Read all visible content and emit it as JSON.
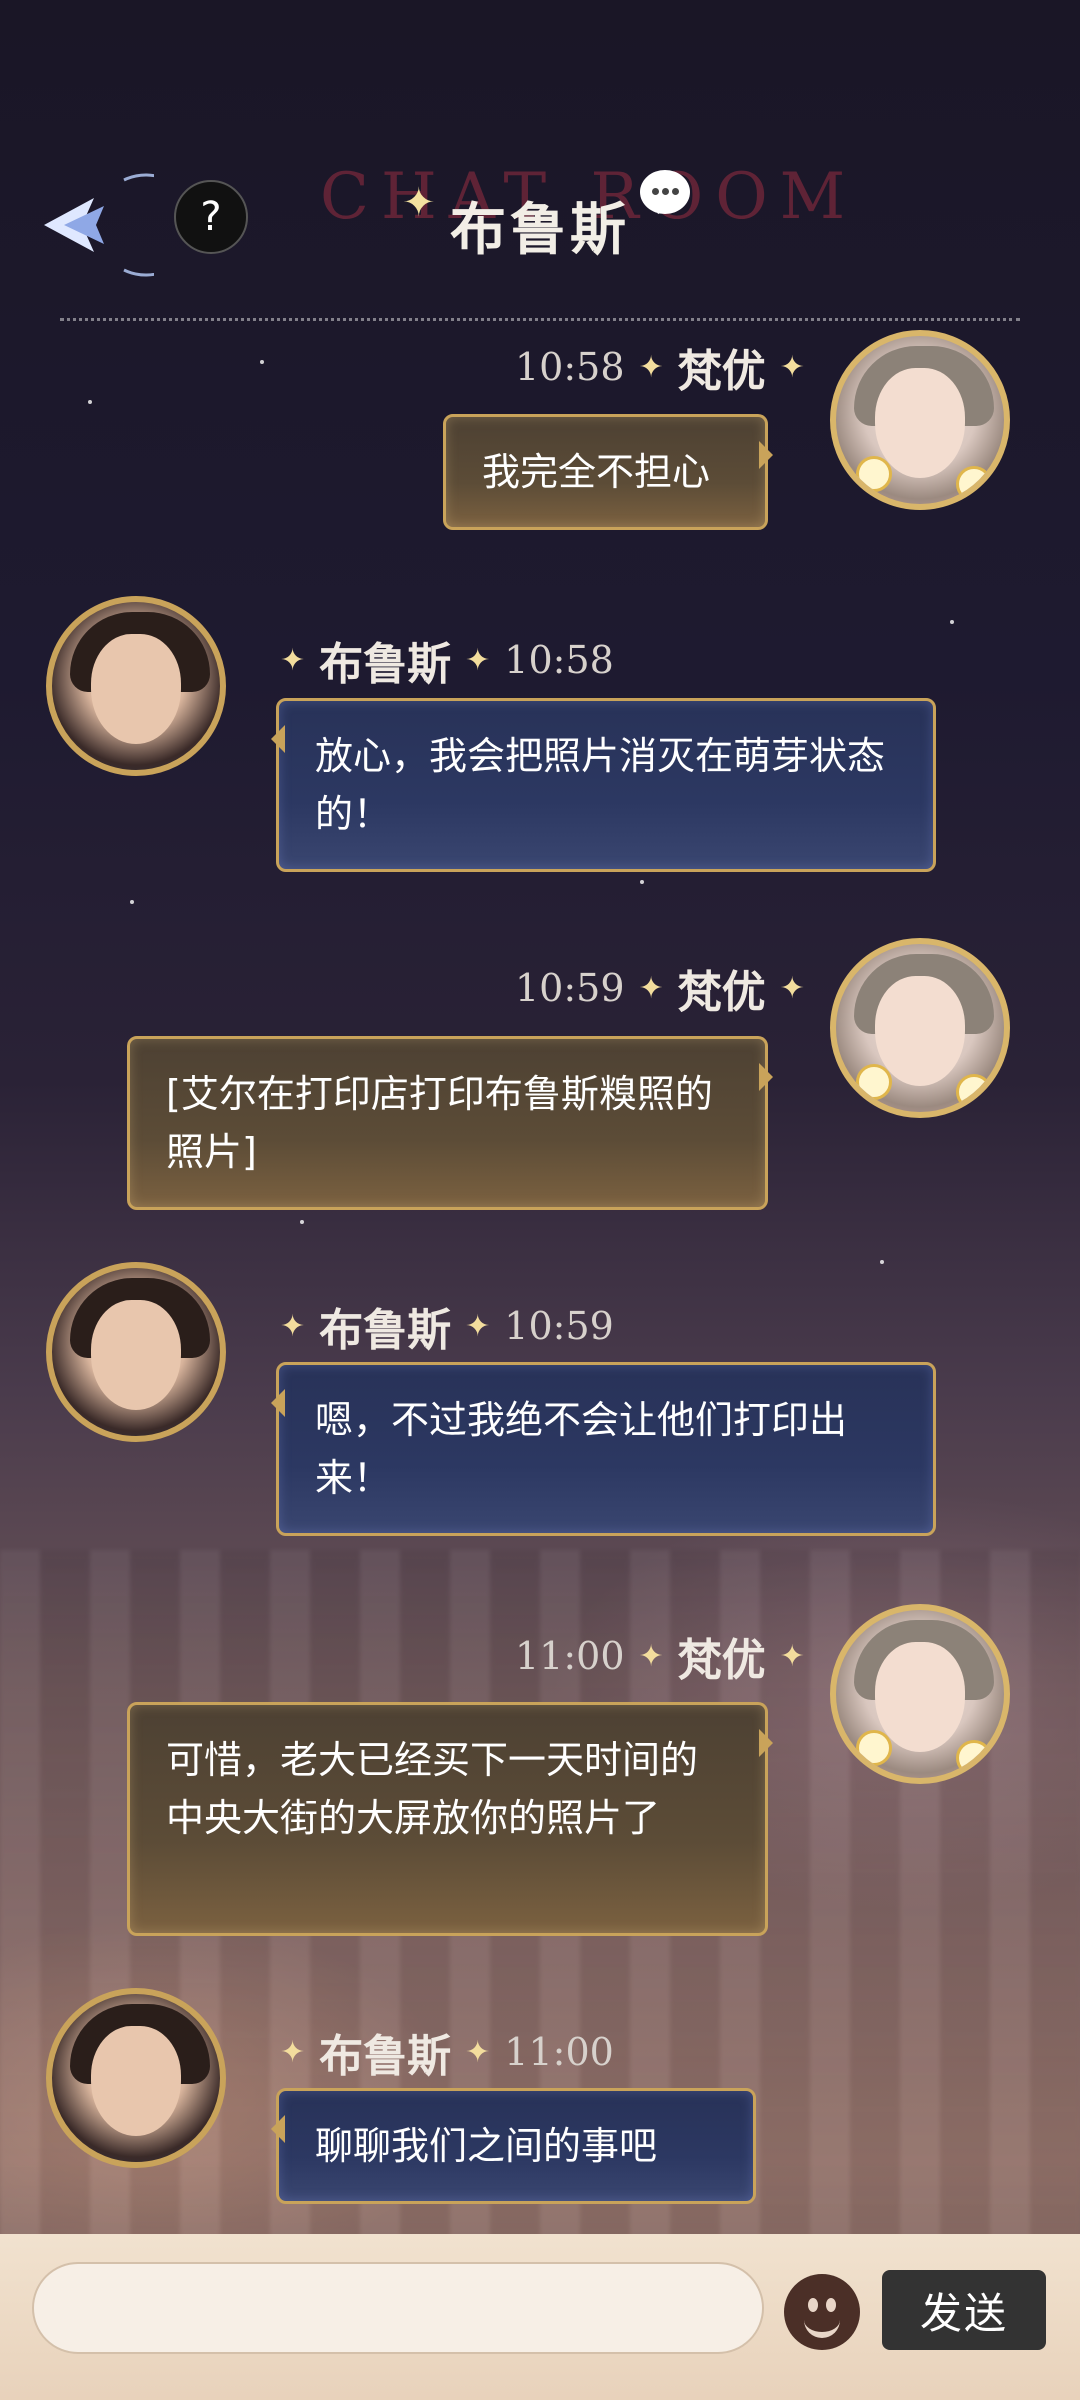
{
  "header": {
    "title": "布鲁斯",
    "watermark": "CHAT ROOM",
    "help_label": "?"
  },
  "messages": [
    {
      "side": "right",
      "time": "10:58",
      "name": "梵优",
      "text": "我完全不担心"
    },
    {
      "side": "left",
      "time": "10:58",
      "name": "布鲁斯",
      "text": "放心，我会把照片消灭在萌芽状态的！"
    },
    {
      "side": "right",
      "time": "10:59",
      "name": "梵优",
      "text": "[艾尔在打印店打印布鲁斯糗照的照片]"
    },
    {
      "side": "left",
      "time": "10:59",
      "name": "布鲁斯",
      "text": "嗯，不过我绝不会让他们打印出来！"
    },
    {
      "side": "right",
      "time": "11:00",
      "name": "梵优",
      "text": "可惜，老大已经买下一天时间的中央大街的大屏放你的照片了"
    },
    {
      "side": "left",
      "time": "11:00",
      "name": "布鲁斯",
      "text": "聊聊我们之间的事吧"
    }
  ],
  "composer": {
    "input_value": "",
    "send_label": "发送",
    "emoji_icon": "emoji-face-icon"
  },
  "colors": {
    "bubble_gold_border": "#c9a35a",
    "bubble_blue_bg": "#2c3862",
    "bubble_brown_bg": "#5c4c37"
  }
}
